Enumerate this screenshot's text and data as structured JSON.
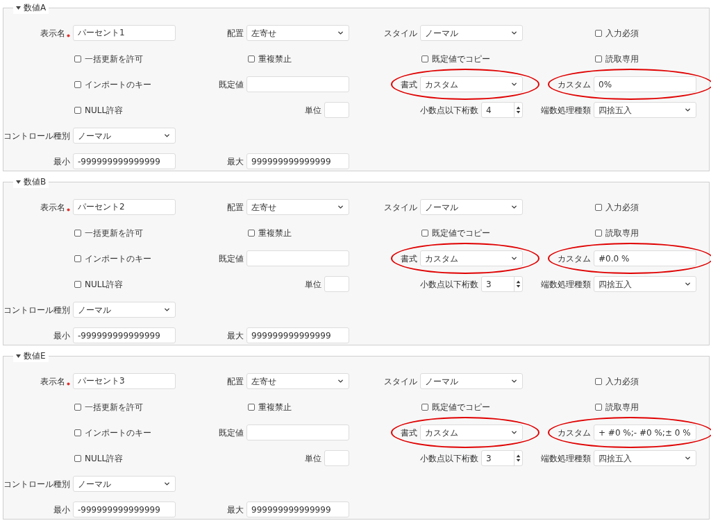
{
  "panels": [
    {
      "title": "数値A",
      "expanded": true,
      "rows": [
        [
          {
            "kind": "text",
            "label": "表示名",
            "value": "パーセント1",
            "required": true,
            "circled": false
          },
          {
            "kind": "select",
            "label": "配置",
            "value": "左寄せ",
            "required": false,
            "circled": false
          },
          {
            "kind": "select",
            "label": "スタイル",
            "value": "ノーマル",
            "required": false,
            "circled": false
          },
          {
            "kind": "checkbox",
            "label": "入力必須",
            "checked": false
          }
        ],
        [
          {
            "kind": "checkbox",
            "label": "一括更新を許可",
            "checked": false
          },
          {
            "kind": "checkbox",
            "label": "重複禁止",
            "checked": false
          },
          {
            "kind": "checkbox",
            "label": "既定値でコピー",
            "checked": false
          },
          {
            "kind": "checkbox",
            "label": "読取専用",
            "checked": false
          }
        ],
        [
          {
            "kind": "checkbox",
            "label": "インポートのキー",
            "checked": false
          },
          {
            "kind": "text",
            "label": "既定値",
            "required": false,
            "circled": false
          },
          {
            "kind": "select",
            "label": "書式",
            "value": "カスタム",
            "required": false,
            "circled": true
          },
          {
            "kind": "text",
            "label": "カスタム",
            "value": "0%",
            "required": false,
            "circled": true
          }
        ],
        [
          {
            "kind": "checkbox",
            "label": "NULL許容",
            "checked": false
          },
          {
            "kind": "short",
            "label": "単位",
            "required": false,
            "circled": false
          },
          {
            "kind": "number",
            "label": "小数点以下桁数",
            "value": "4",
            "required": false,
            "circled": false
          },
          {
            "kind": "select",
            "label": "端数処理種類",
            "value": "四捨五入",
            "required": false,
            "circled": false
          }
        ],
        [
          {
            "kind": "select",
            "label": "コントロール種別",
            "value": "ノーマル",
            "required": false,
            "circled": false
          }
        ],
        [
          {
            "kind": "text",
            "label": "最小",
            "value": "-999999999999999",
            "required": false,
            "circled": false
          },
          {
            "kind": "text",
            "label": "最大",
            "value": "999999999999999",
            "required": false,
            "circled": false
          }
        ]
      ]
    },
    {
      "title": "数値B",
      "expanded": true,
      "rows": [
        [
          {
            "kind": "text",
            "label": "表示名",
            "value": "パーセント2",
            "required": true,
            "circled": false
          },
          {
            "kind": "select",
            "label": "配置",
            "value": "左寄せ",
            "required": false,
            "circled": false
          },
          {
            "kind": "select",
            "label": "スタイル",
            "value": "ノーマル",
            "required": false,
            "circled": false
          },
          {
            "kind": "checkbox",
            "label": "入力必須",
            "checked": false
          }
        ],
        [
          {
            "kind": "checkbox",
            "label": "一括更新を許可",
            "checked": false
          },
          {
            "kind": "checkbox",
            "label": "重複禁止",
            "checked": false
          },
          {
            "kind": "checkbox",
            "label": "既定値でコピー",
            "checked": false
          },
          {
            "kind": "checkbox",
            "label": "読取専用",
            "checked": false
          }
        ],
        [
          {
            "kind": "checkbox",
            "label": "インポートのキー",
            "checked": false
          },
          {
            "kind": "text",
            "label": "既定値",
            "required": false,
            "circled": false
          },
          {
            "kind": "select",
            "label": "書式",
            "value": "カスタム",
            "required": false,
            "circled": true
          },
          {
            "kind": "text",
            "label": "カスタム",
            "value": "#0.0 %",
            "required": false,
            "circled": true
          }
        ],
        [
          {
            "kind": "checkbox",
            "label": "NULL許容",
            "checked": false
          },
          {
            "kind": "short",
            "label": "単位",
            "required": false,
            "circled": false
          },
          {
            "kind": "number",
            "label": "小数点以下桁数",
            "value": "3",
            "required": false,
            "circled": false
          },
          {
            "kind": "select",
            "label": "端数処理種類",
            "value": "四捨五入",
            "required": false,
            "circled": false
          }
        ],
        [
          {
            "kind": "select",
            "label": "コントロール種別",
            "value": "ノーマル",
            "required": false,
            "circled": false
          }
        ],
        [
          {
            "kind": "text",
            "label": "最小",
            "value": "-999999999999999",
            "required": false,
            "circled": false
          },
          {
            "kind": "text",
            "label": "最大",
            "value": "999999999999999",
            "required": false,
            "circled": false
          }
        ]
      ]
    },
    {
      "title": "数値E",
      "expanded": true,
      "rows": [
        [
          {
            "kind": "text",
            "label": "表示名",
            "value": "パーセント3",
            "required": true,
            "circled": false
          },
          {
            "kind": "select",
            "label": "配置",
            "value": "左寄せ",
            "required": false,
            "circled": false
          },
          {
            "kind": "select",
            "label": "スタイル",
            "value": "ノーマル",
            "required": false,
            "circled": false
          },
          {
            "kind": "checkbox",
            "label": "入力必須",
            "checked": false
          }
        ],
        [
          {
            "kind": "checkbox",
            "label": "一括更新を許可",
            "checked": false
          },
          {
            "kind": "checkbox",
            "label": "重複禁止",
            "checked": false
          },
          {
            "kind": "checkbox",
            "label": "既定値でコピー",
            "checked": false
          },
          {
            "kind": "checkbox",
            "label": "読取専用",
            "checked": false
          }
        ],
        [
          {
            "kind": "checkbox",
            "label": "インポートのキー",
            "checked": false
          },
          {
            "kind": "text",
            "label": "既定値",
            "required": false,
            "circled": false
          },
          {
            "kind": "select",
            "label": "書式",
            "value": "カスタム",
            "required": false,
            "circled": true
          },
          {
            "kind": "text",
            "label": "カスタム",
            "value": "+ #0 %;- #0 %;± 0 %",
            "required": false,
            "circled": true
          }
        ],
        [
          {
            "kind": "checkbox",
            "label": "NULL許容",
            "checked": false
          },
          {
            "kind": "short",
            "label": "単位",
            "required": false,
            "circled": false
          },
          {
            "kind": "number",
            "label": "小数点以下桁数",
            "value": "3",
            "required": false,
            "circled": false
          },
          {
            "kind": "select",
            "label": "端数処理種類",
            "value": "四捨五入",
            "required": false,
            "circled": false
          }
        ],
        [
          {
            "kind": "select",
            "label": "コントロール種別",
            "value": "ノーマル",
            "required": false,
            "circled": false
          }
        ],
        [
          {
            "kind": "text",
            "label": "最小",
            "value": "-999999999999999",
            "required": false,
            "circled": false
          },
          {
            "kind": "text",
            "label": "最大",
            "value": "999999999999999",
            "required": false,
            "circled": false
          }
        ]
      ]
    }
  ]
}
